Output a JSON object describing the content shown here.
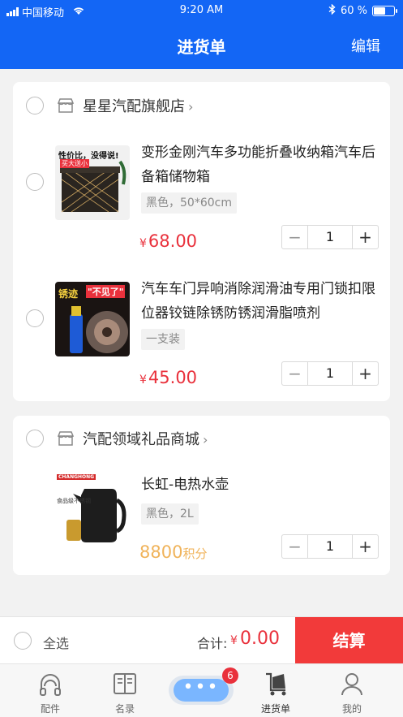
{
  "status_bar": {
    "carrier": "中国移动",
    "time": "9:20 AM",
    "battery": "60 %",
    "battery_level": 0.6
  },
  "header": {
    "title": "进货单",
    "edit_label": "编辑"
  },
  "stores": [
    {
      "name": "星星汽配旗舰店",
      "items": [
        {
          "title": "变形金刚汽车多功能折叠收纳箱汽车后备箱储物箱",
          "spec": "黑色，50*60cm",
          "price_symbol": "¥",
          "price": "68.00",
          "qty": "1",
          "thumb_text_top": "性价比，没得说!",
          "thumb_text_tag": "买大送小"
        },
        {
          "title": "汽车车门异响消除润滑油专用门锁扣限位器铰链除锈防锈润滑脂喷剂",
          "spec": "一支装",
          "price_symbol": "¥",
          "price": "45.00",
          "qty": "1",
          "thumb_text_top": "锈迹",
          "thumb_text_tag": "\"不见了\""
        }
      ]
    },
    {
      "name": "汽配领域礼品商城",
      "items": [
        {
          "title": "长虹-电热水壶",
          "spec": "黑色，2L",
          "points": "8800",
          "points_unit": "积分",
          "qty": "1",
          "thumb_text_top": "CHANGHONG",
          "thumb_text_tag": "食品级不锈钢"
        }
      ]
    }
  ],
  "checkout": {
    "select_all": "全选",
    "total_label": "合计:",
    "total_symbol": "¥",
    "total_value": "0.00",
    "pay_label": "结算"
  },
  "tabbar": {
    "tabs": [
      {
        "label": "配件",
        "icon": "headset-icon"
      },
      {
        "label": "名录",
        "icon": "book-icon"
      },
      {
        "label": "",
        "icon": "chat-bubble-icon"
      },
      {
        "label": "进货单",
        "icon": "cart-icon"
      },
      {
        "label": "我的",
        "icon": "user-icon"
      }
    ],
    "badge": "6"
  },
  "colors": {
    "brand_blue": "#1366f5",
    "price_red": "#e9313c",
    "pay_red": "#f23a3a",
    "points_orange": "#f0b35a"
  }
}
